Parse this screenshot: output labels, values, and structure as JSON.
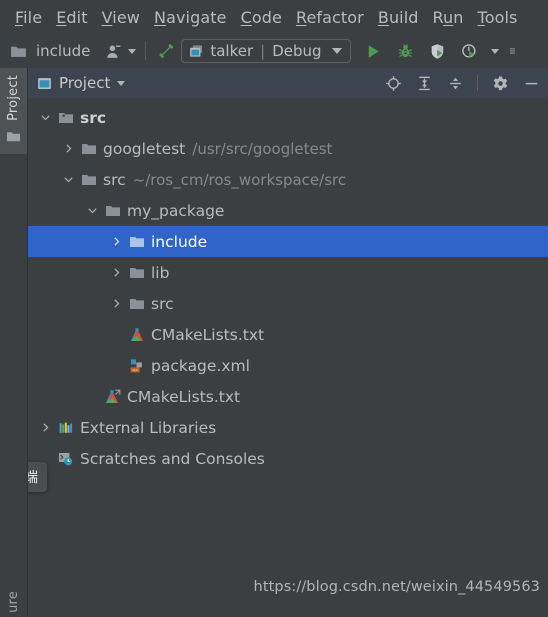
{
  "menubar": {
    "items": [
      {
        "mnemonic": "F",
        "rest": "ile"
      },
      {
        "mnemonic": "E",
        "rest": "dit"
      },
      {
        "mnemonic": "V",
        "rest": "iew"
      },
      {
        "mnemonic": "N",
        "rest": "avigate"
      },
      {
        "mnemonic": "C",
        "rest": "ode"
      },
      {
        "mnemonic": "R",
        "rest": "efactor"
      },
      {
        "mnemonic": "B",
        "rest": "uild"
      },
      {
        "mnemonic": "R",
        "rest": "un",
        "prefix": "R",
        "mid": "u",
        "suffix": "n"
      },
      {
        "mnemonic": "T",
        "rest": "ools"
      }
    ]
  },
  "toolbar": {
    "breadcrumb": "include",
    "breadcrumb_icon": "folder-icon",
    "vcs_icon": "person-icon",
    "build_icon": "hammer-icon",
    "run_config": {
      "icon": "run-config-icon",
      "name": "talker",
      "separator": "|",
      "mode": "Debug",
      "dropdown_icon": "chevron-down-icon"
    },
    "actions": [
      {
        "name": "run-button",
        "icon": "run-icon"
      },
      {
        "name": "debug-button",
        "icon": "bug-icon"
      },
      {
        "name": "coverage-button",
        "icon": "coverage-icon"
      },
      {
        "name": "profile-button",
        "icon": "profiler-icon"
      },
      {
        "name": "more-run-options",
        "icon": "chevron-down-icon"
      },
      {
        "name": "overflow-menu",
        "icon": "kebab-icon"
      }
    ]
  },
  "toolstrip": {
    "top_tab": {
      "label": "Project",
      "icon": "folder-icon"
    },
    "bottom_tab": {
      "label": "ure",
      "full_label": "Structure"
    },
    "tooltip": "终端"
  },
  "panel": {
    "title": "Project",
    "title_icon": "project-window-icon",
    "title_dropdown_icon": "chevron-down-icon",
    "actions": [
      {
        "name": "select-opened-file-button",
        "icon": "crosshair-icon"
      },
      {
        "name": "expand-all-button",
        "icon": "expand-all-icon"
      },
      {
        "name": "collapse-all-button",
        "icon": "collapse-all-icon"
      },
      {
        "name": "settings-button",
        "icon": "gear-icon"
      },
      {
        "name": "hide-button",
        "icon": "minimize-icon"
      }
    ]
  },
  "tree": {
    "rows": [
      {
        "depth": 0,
        "arrow": "down",
        "icon": "project-root-folder-icon",
        "label": "src",
        "bold": true,
        "sub": "",
        "selected": false
      },
      {
        "depth": 1,
        "arrow": "right",
        "icon": "folder-icon",
        "label": "googletest",
        "bold": false,
        "sub": "/usr/src/googletest",
        "selected": false
      },
      {
        "depth": 1,
        "arrow": "down",
        "icon": "folder-icon",
        "label": "src",
        "bold": false,
        "sub": "~/ros_cm/ros_workspace/src",
        "selected": false
      },
      {
        "depth": 2,
        "arrow": "down",
        "icon": "folder-icon",
        "label": "my_package",
        "bold": false,
        "sub": "",
        "selected": false
      },
      {
        "depth": 3,
        "arrow": "right",
        "icon": "folder-icon",
        "label": "include",
        "bold": false,
        "sub": "",
        "selected": true
      },
      {
        "depth": 3,
        "arrow": "right",
        "icon": "folder-icon",
        "label": "lib",
        "bold": false,
        "sub": "",
        "selected": false
      },
      {
        "depth": 3,
        "arrow": "right",
        "icon": "folder-icon",
        "label": "src",
        "bold": false,
        "sub": "",
        "selected": false
      },
      {
        "depth": 3,
        "arrow": "none",
        "icon": "cmake-file-icon",
        "label": "CMakeLists.txt",
        "bold": false,
        "sub": "",
        "selected": false
      },
      {
        "depth": 3,
        "arrow": "none",
        "icon": "xml-file-icon",
        "label": "package.xml",
        "bold": false,
        "sub": "",
        "selected": false
      },
      {
        "depth": 2,
        "arrow": "none",
        "icon": "cmake-link-file-icon",
        "label": "CMakeLists.txt",
        "bold": false,
        "sub": "",
        "selected": false
      },
      {
        "depth": 0,
        "arrow": "right",
        "icon": "external-libraries-icon",
        "label": "External Libraries",
        "bold": false,
        "sub": "",
        "selected": false
      },
      {
        "depth": 0,
        "arrow": "none",
        "icon": "scratches-icon",
        "label": "Scratches and Consoles",
        "bold": false,
        "sub": "",
        "selected": false
      }
    ]
  },
  "watermark": "https://blog.csdn.net/weixin_44549563",
  "colors": {
    "background": "#3c3f41",
    "panel_header": "#3c4450",
    "selection": "#2f65c8",
    "text": "#bbbbbb",
    "muted_text": "#888888",
    "accent_green": "#499c54",
    "folder": "#8a9299",
    "tooltip_bg": "#4a4e50"
  }
}
